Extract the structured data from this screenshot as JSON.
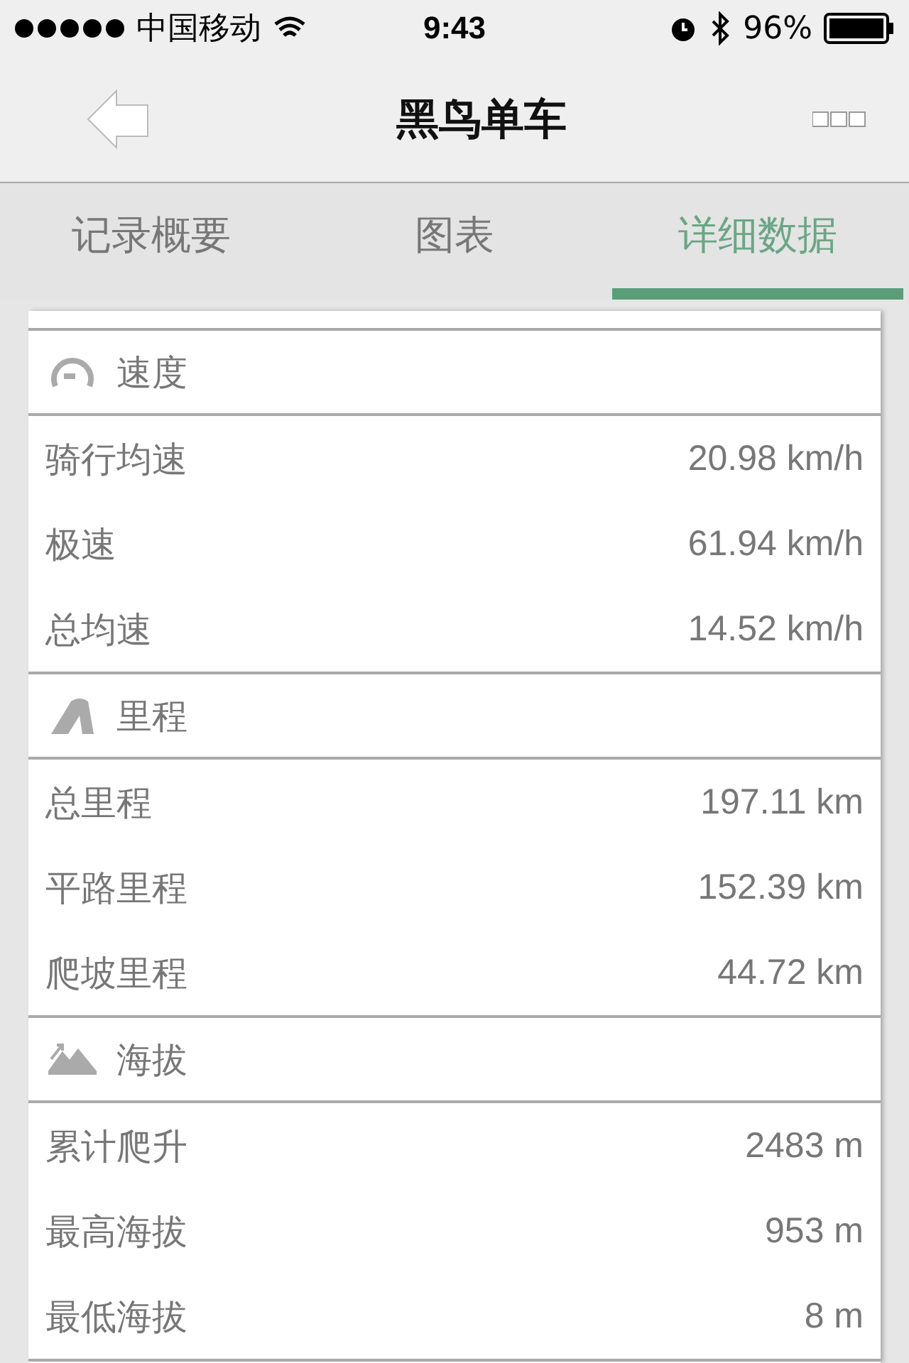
{
  "status_bar": {
    "carrier": "中国移动",
    "time": "9:43",
    "battery": "96%"
  },
  "nav": {
    "title": "黑鸟单车"
  },
  "tabs": [
    {
      "label": "记录概要",
      "selected": false
    },
    {
      "label": "图表",
      "selected": false
    },
    {
      "label": "详细数据",
      "selected": true
    }
  ],
  "sections": [
    {
      "kind": "speed",
      "title": "速度",
      "rows": [
        {
          "label": "骑行均速",
          "value": "20.98 km/h"
        },
        {
          "label": "极速",
          "value": "61.94 km/h"
        },
        {
          "label": "总均速",
          "value": "14.52 km/h"
        }
      ]
    },
    {
      "kind": "distance",
      "title": "里程",
      "rows": [
        {
          "label": "总里程",
          "value": "197.11 km"
        },
        {
          "label": "平路里程",
          "value": "152.39 km"
        },
        {
          "label": "爬坡里程",
          "value": "44.72 km"
        }
      ]
    },
    {
      "kind": "altitude",
      "title": "海拔",
      "rows": [
        {
          "label": "累计爬升",
          "value": "2483 m"
        },
        {
          "label": "最高海拔",
          "value": "953 m"
        },
        {
          "label": "最低海拔",
          "value": "8 m"
        }
      ]
    }
  ]
}
